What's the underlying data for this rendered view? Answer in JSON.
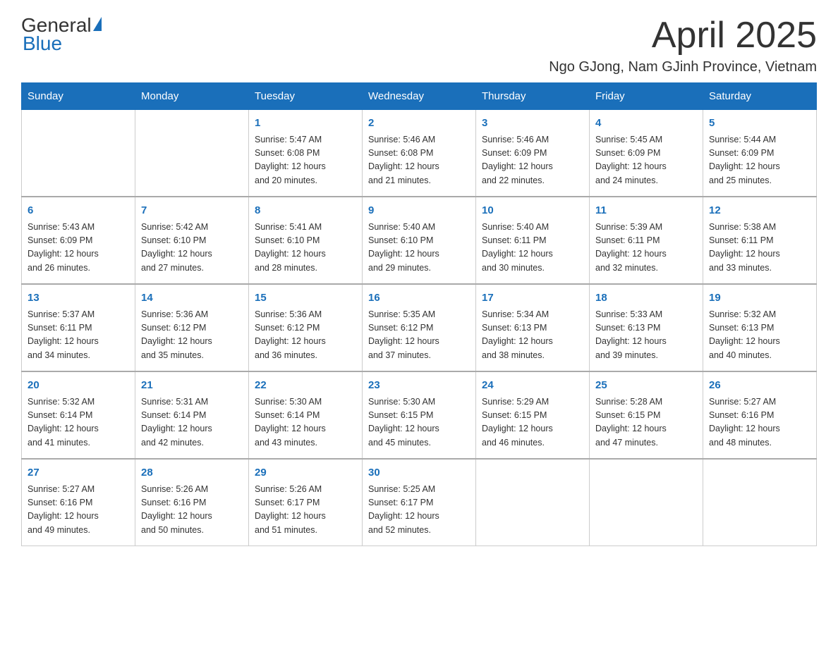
{
  "logo": {
    "general": "General",
    "blue": "Blue"
  },
  "title": "April 2025",
  "location": "Ngo GJong, Nam GJinh Province, Vietnam",
  "weekdays": [
    "Sunday",
    "Monday",
    "Tuesday",
    "Wednesday",
    "Thursday",
    "Friday",
    "Saturday"
  ],
  "weeks": [
    [
      {
        "day": "",
        "info": ""
      },
      {
        "day": "",
        "info": ""
      },
      {
        "day": "1",
        "info": "Sunrise: 5:47 AM\nSunset: 6:08 PM\nDaylight: 12 hours\nand 20 minutes."
      },
      {
        "day": "2",
        "info": "Sunrise: 5:46 AM\nSunset: 6:08 PM\nDaylight: 12 hours\nand 21 minutes."
      },
      {
        "day": "3",
        "info": "Sunrise: 5:46 AM\nSunset: 6:09 PM\nDaylight: 12 hours\nand 22 minutes."
      },
      {
        "day": "4",
        "info": "Sunrise: 5:45 AM\nSunset: 6:09 PM\nDaylight: 12 hours\nand 24 minutes."
      },
      {
        "day": "5",
        "info": "Sunrise: 5:44 AM\nSunset: 6:09 PM\nDaylight: 12 hours\nand 25 minutes."
      }
    ],
    [
      {
        "day": "6",
        "info": "Sunrise: 5:43 AM\nSunset: 6:09 PM\nDaylight: 12 hours\nand 26 minutes."
      },
      {
        "day": "7",
        "info": "Sunrise: 5:42 AM\nSunset: 6:10 PM\nDaylight: 12 hours\nand 27 minutes."
      },
      {
        "day": "8",
        "info": "Sunrise: 5:41 AM\nSunset: 6:10 PM\nDaylight: 12 hours\nand 28 minutes."
      },
      {
        "day": "9",
        "info": "Sunrise: 5:40 AM\nSunset: 6:10 PM\nDaylight: 12 hours\nand 29 minutes."
      },
      {
        "day": "10",
        "info": "Sunrise: 5:40 AM\nSunset: 6:11 PM\nDaylight: 12 hours\nand 30 minutes."
      },
      {
        "day": "11",
        "info": "Sunrise: 5:39 AM\nSunset: 6:11 PM\nDaylight: 12 hours\nand 32 minutes."
      },
      {
        "day": "12",
        "info": "Sunrise: 5:38 AM\nSunset: 6:11 PM\nDaylight: 12 hours\nand 33 minutes."
      }
    ],
    [
      {
        "day": "13",
        "info": "Sunrise: 5:37 AM\nSunset: 6:11 PM\nDaylight: 12 hours\nand 34 minutes."
      },
      {
        "day": "14",
        "info": "Sunrise: 5:36 AM\nSunset: 6:12 PM\nDaylight: 12 hours\nand 35 minutes."
      },
      {
        "day": "15",
        "info": "Sunrise: 5:36 AM\nSunset: 6:12 PM\nDaylight: 12 hours\nand 36 minutes."
      },
      {
        "day": "16",
        "info": "Sunrise: 5:35 AM\nSunset: 6:12 PM\nDaylight: 12 hours\nand 37 minutes."
      },
      {
        "day": "17",
        "info": "Sunrise: 5:34 AM\nSunset: 6:13 PM\nDaylight: 12 hours\nand 38 minutes."
      },
      {
        "day": "18",
        "info": "Sunrise: 5:33 AM\nSunset: 6:13 PM\nDaylight: 12 hours\nand 39 minutes."
      },
      {
        "day": "19",
        "info": "Sunrise: 5:32 AM\nSunset: 6:13 PM\nDaylight: 12 hours\nand 40 minutes."
      }
    ],
    [
      {
        "day": "20",
        "info": "Sunrise: 5:32 AM\nSunset: 6:14 PM\nDaylight: 12 hours\nand 41 minutes."
      },
      {
        "day": "21",
        "info": "Sunrise: 5:31 AM\nSunset: 6:14 PM\nDaylight: 12 hours\nand 42 minutes."
      },
      {
        "day": "22",
        "info": "Sunrise: 5:30 AM\nSunset: 6:14 PM\nDaylight: 12 hours\nand 43 minutes."
      },
      {
        "day": "23",
        "info": "Sunrise: 5:30 AM\nSunset: 6:15 PM\nDaylight: 12 hours\nand 45 minutes."
      },
      {
        "day": "24",
        "info": "Sunrise: 5:29 AM\nSunset: 6:15 PM\nDaylight: 12 hours\nand 46 minutes."
      },
      {
        "day": "25",
        "info": "Sunrise: 5:28 AM\nSunset: 6:15 PM\nDaylight: 12 hours\nand 47 minutes."
      },
      {
        "day": "26",
        "info": "Sunrise: 5:27 AM\nSunset: 6:16 PM\nDaylight: 12 hours\nand 48 minutes."
      }
    ],
    [
      {
        "day": "27",
        "info": "Sunrise: 5:27 AM\nSunset: 6:16 PM\nDaylight: 12 hours\nand 49 minutes."
      },
      {
        "day": "28",
        "info": "Sunrise: 5:26 AM\nSunset: 6:16 PM\nDaylight: 12 hours\nand 50 minutes."
      },
      {
        "day": "29",
        "info": "Sunrise: 5:26 AM\nSunset: 6:17 PM\nDaylight: 12 hours\nand 51 minutes."
      },
      {
        "day": "30",
        "info": "Sunrise: 5:25 AM\nSunset: 6:17 PM\nDaylight: 12 hours\nand 52 minutes."
      },
      {
        "day": "",
        "info": ""
      },
      {
        "day": "",
        "info": ""
      },
      {
        "day": "",
        "info": ""
      }
    ]
  ]
}
